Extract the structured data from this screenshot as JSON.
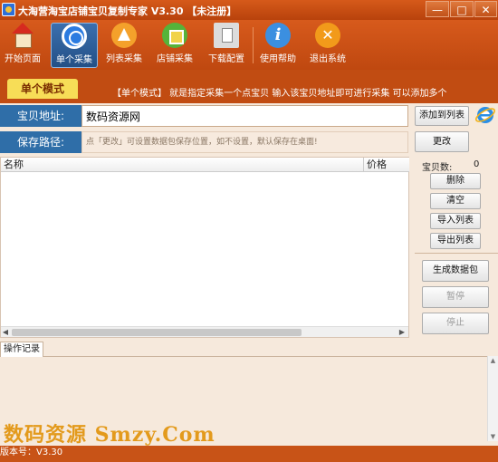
{
  "window": {
    "title": "大淘营淘宝店铺宝贝复制专家 V3.30 【未注册】",
    "min_symbol": "—",
    "max_symbol": "□",
    "close_symbol": "✕"
  },
  "toolbar": {
    "items": [
      {
        "label": "开始页面",
        "icon": "home-icon"
      },
      {
        "label": "单个采集",
        "icon": "single-collect-icon"
      },
      {
        "label": "列表采集",
        "icon": "list-collect-icon"
      },
      {
        "label": "店铺采集",
        "icon": "shop-collect-icon"
      },
      {
        "label": "下载配置",
        "icon": "download-config-icon"
      },
      {
        "label": "使用帮助",
        "icon": "help-icon"
      },
      {
        "label": "退出系统",
        "icon": "exit-icon"
      }
    ],
    "help_glyph": "i",
    "exit_glyph": "✕"
  },
  "mode": {
    "tab_label": "单个模式",
    "description": "【单个模式】 就是指定采集一个点宝贝  输入该宝贝地址即可进行采集  可以添加多个"
  },
  "form": {
    "url_label": "宝贝地址:",
    "url_value": "数码资源网",
    "add_button": "添加到列表",
    "save_label": "保存路径:",
    "save_placeholder": "点「更改」可设置数据包保存位置，如不设置，默认保存在桌面!",
    "change_button": "更改"
  },
  "table": {
    "columns": [
      "名称",
      "价格"
    ],
    "rows": []
  },
  "side": {
    "count_label": "宝贝数:",
    "count_value": "0",
    "delete_button": "删除",
    "clear_button": "清空",
    "import_button": "导入列表",
    "export_button": "导出列表",
    "pack_button": "生成数据包",
    "pause_button": "暂停",
    "stop_button": "停止"
  },
  "log": {
    "tab_label": "操作记录"
  },
  "watermark": "数码资源 Smzy.Com",
  "status": {
    "version": "版本号：V3.30"
  },
  "colors": {
    "title_bar": "#c14c12",
    "mode_tab": "#f7dd57",
    "label_blue": "#2f6ea8",
    "watermark": "#e39a1c"
  }
}
